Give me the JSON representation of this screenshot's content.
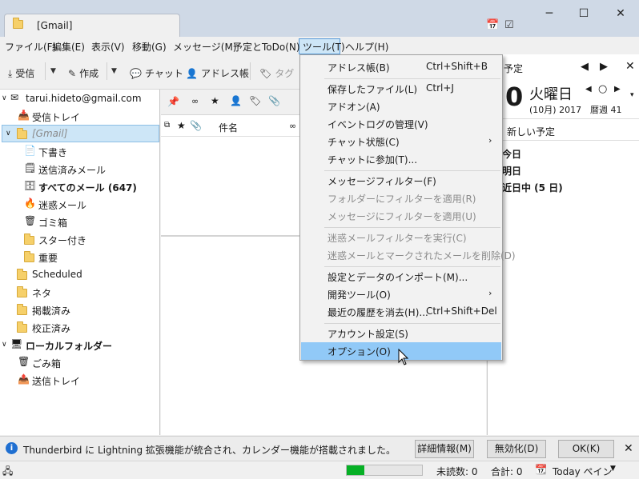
{
  "window": {
    "tab_title": "[Gmail]",
    "minimize": "─",
    "maximize": "☐",
    "close": "✕"
  },
  "menubar": [
    "ファイル(F)",
    "編集(E)",
    "表示(V)",
    "移動(G)",
    "メッセージ(M)",
    "予定とToDo(N)",
    "ツール(T)",
    "ヘルプ(H)"
  ],
  "toolbar": {
    "receive": "受信",
    "compose": "作成",
    "chat": "チャット",
    "addressbook": "アドレス帳",
    "tag": "タグ"
  },
  "folders": {
    "account": "tarui.hideto@gmail.com",
    "inbox": "受信トレイ",
    "gmail": "[Gmail]",
    "drafts": "下書き",
    "sent": "送信済みメール",
    "allmail": "すべてのメール (647)",
    "spam": "迷惑メール",
    "trash": "ゴミ箱",
    "starred": "スター付き",
    "important": "重要",
    "scheduled": "Scheduled",
    "neta": "ネタ",
    "keisai": "掲載済み",
    "kosei": "校正済み",
    "local": "ローカルフォルダー",
    "local_trash": "ごみ箱",
    "outbox": "送信トレイ"
  },
  "thread_header": {
    "subject": "件名"
  },
  "today_pane": {
    "title": "予定",
    "day": "0",
    "weekday": "火曜日",
    "month_year": "(10月) 2017",
    "week": "暦週 41",
    "new_event": "新しい予定",
    "sections": [
      "今日",
      "明日",
      "近日中 (5 日)"
    ]
  },
  "tools_menu": [
    {
      "label": "アドレス帳(B)",
      "shortcut": "Ctrl+Shift+B",
      "disabled": false
    },
    {
      "sep": true
    },
    {
      "label": "保存したファイル(L)",
      "shortcut": "Ctrl+J",
      "disabled": false
    },
    {
      "label": "アドオン(A)",
      "shortcut": "",
      "disabled": false
    },
    {
      "label": "イベントログの管理(V)",
      "shortcut": "",
      "disabled": false
    },
    {
      "label": "チャット状態(C)",
      "shortcut": "",
      "disabled": false,
      "submenu": true
    },
    {
      "label": "チャットに参加(T)...",
      "shortcut": "",
      "disabled": false
    },
    {
      "sep": true
    },
    {
      "label": "メッセージフィルター(F)",
      "shortcut": "",
      "disabled": false
    },
    {
      "label": "フォルダーにフィルターを適用(R)",
      "shortcut": "",
      "disabled": true
    },
    {
      "label": "メッセージにフィルターを適用(U)",
      "shortcut": "",
      "disabled": true
    },
    {
      "sep": true
    },
    {
      "label": "迷惑メールフィルターを実行(C)",
      "shortcut": "",
      "disabled": true
    },
    {
      "label": "迷惑メールとマークされたメールを削除(D)",
      "shortcut": "",
      "disabled": true
    },
    {
      "sep": true
    },
    {
      "label": "設定とデータのインポート(M)...",
      "shortcut": "",
      "disabled": false
    },
    {
      "label": "開発ツール(O)",
      "shortcut": "",
      "disabled": false,
      "submenu": true
    },
    {
      "label": "最近の履歴を消去(H)...",
      "shortcut": "Ctrl+Shift+Del",
      "disabled": false
    },
    {
      "sep": true
    },
    {
      "label": "アカウント設定(S)",
      "shortcut": "",
      "disabled": false
    },
    {
      "label": "オプション(O)",
      "shortcut": "",
      "disabled": false,
      "highlighted": true
    }
  ],
  "notification": {
    "text": "Thunderbird に Lightning 拡張機能が統合され、カレンダー機能が搭載されました。",
    "details": "詳細情報(M)",
    "disable": "無効化(D)",
    "ok": "OK(K)"
  },
  "statusbar": {
    "unread": "未読数: 0",
    "total": "合計: 0",
    "today_pane": "Today ペイン",
    "progress_fraction": 0.23
  }
}
